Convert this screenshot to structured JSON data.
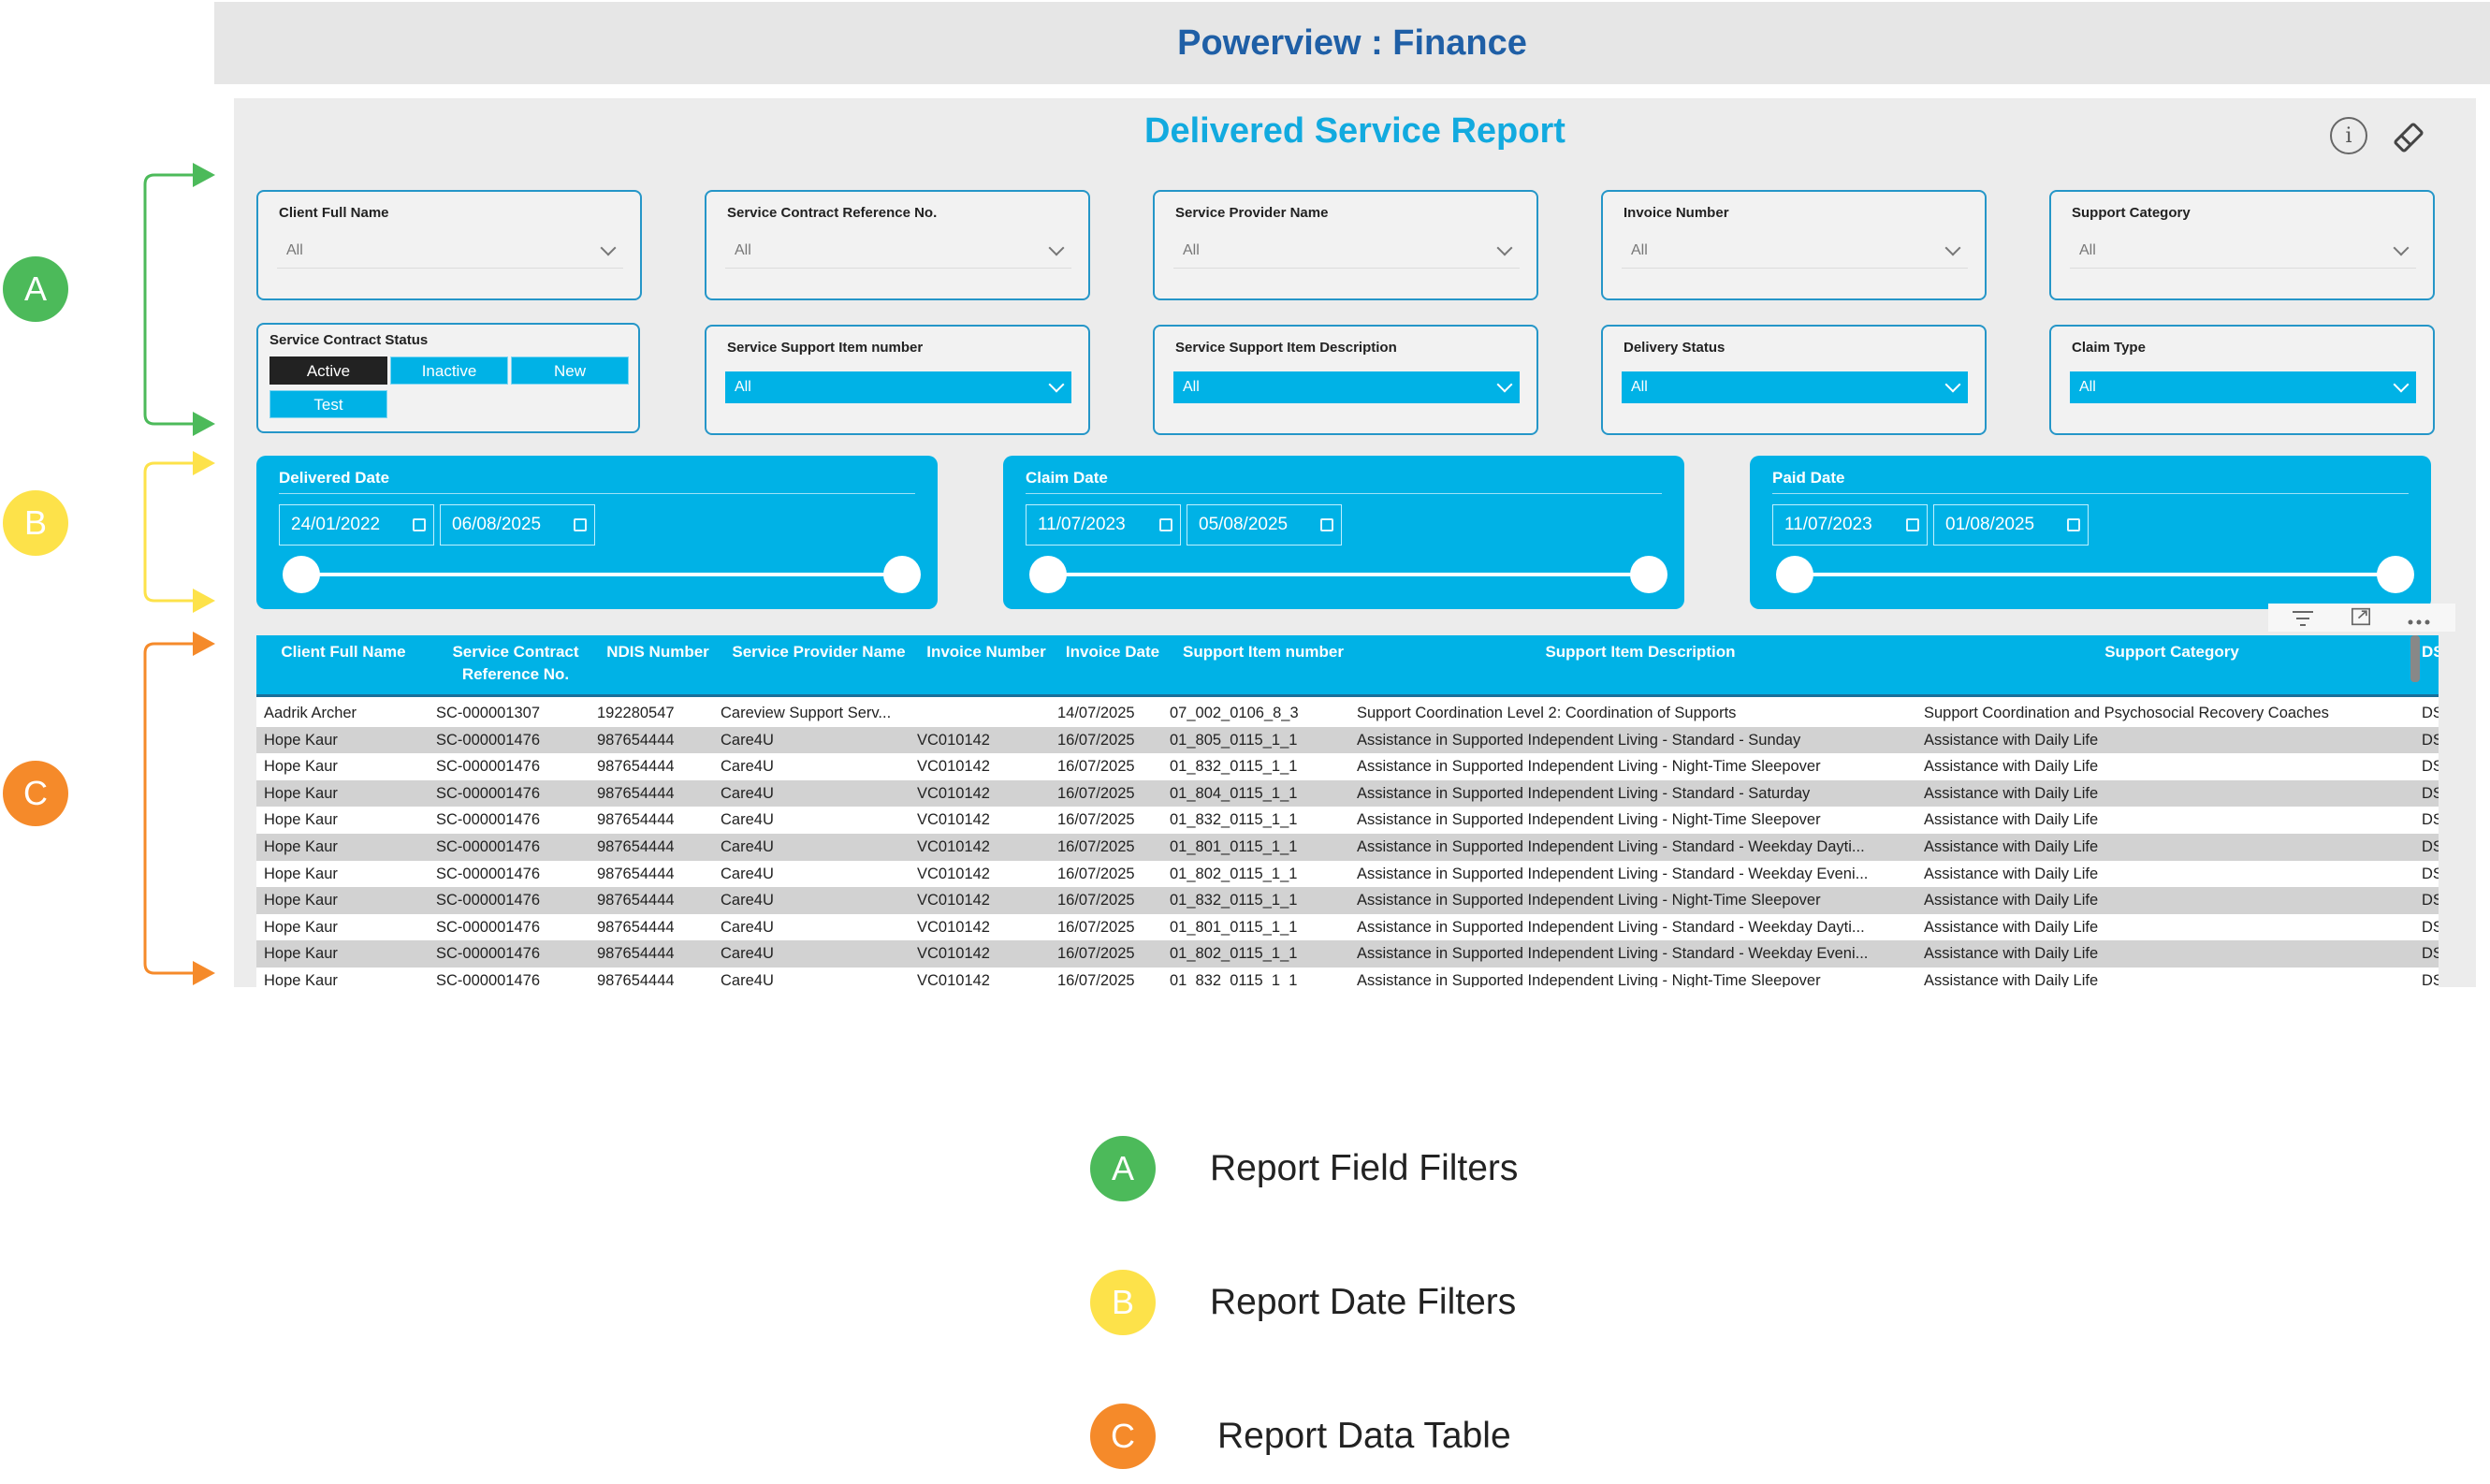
{
  "app": {
    "title": "Powerview : Finance"
  },
  "report": {
    "title": "Delivered Service Report",
    "info_glyph": "i"
  },
  "field_filters": [
    {
      "label": "Client Full Name",
      "value": "All"
    },
    {
      "label": "Service Contract Reference No.",
      "value": "All"
    },
    {
      "label": "Service Provider Name",
      "value": "All"
    },
    {
      "label": "Invoice Number",
      "value": "All"
    },
    {
      "label": "Support Category",
      "value": "All"
    }
  ],
  "field_filters_row2": [
    {
      "label": "Service Support Item number",
      "value": "All"
    },
    {
      "label": "Service Support Item Description",
      "value": "All"
    },
    {
      "label": "Delivery Status",
      "value": "All"
    },
    {
      "label": "Claim Type",
      "value": "All"
    }
  ],
  "contract_status": {
    "label": "Service Contract Status",
    "options": [
      "Active",
      "Inactive",
      "New",
      "Test"
    ],
    "selected": "Active"
  },
  "date_filters": [
    {
      "label": "Delivered Date",
      "from": "24/01/2022",
      "to": "06/08/2025"
    },
    {
      "label": "Claim Date",
      "from": "11/07/2023",
      "to": "05/08/2025"
    },
    {
      "label": "Paid Date",
      "from": "11/07/2023",
      "to": "01/08/2025"
    }
  ],
  "table": {
    "headers": [
      "Client Full Name",
      "Service Contract\nReference No.",
      "NDIS Number",
      "Service Provider Name",
      "Invoice Number",
      "Invoice Date",
      "Support Item number",
      "Support Item Description",
      "Support Category",
      "DS"
    ],
    "rows": [
      [
        "Aadrik Archer",
        "SC-000001307",
        "192280547",
        "Careview Support Serv...",
        "",
        "14/07/2025",
        "07_002_0106_8_3",
        "Support Coordination Level 2: Coordination of Supports",
        "Support Coordination and Psychosocial Recovery Coaches",
        "DS-("
      ],
      [
        "Hope Kaur",
        "SC-000001476",
        "987654444",
        "Care4U",
        "VC010142",
        "16/07/2025",
        "01_805_0115_1_1",
        "Assistance in Supported Independent Living - Standard - Sunday",
        "Assistance with Daily Life",
        "DS-("
      ],
      [
        "Hope Kaur",
        "SC-000001476",
        "987654444",
        "Care4U",
        "VC010142",
        "16/07/2025",
        "01_832_0115_1_1",
        "Assistance in Supported Independent Living - Night-Time Sleepover",
        "Assistance with Daily Life",
        "DS-("
      ],
      [
        "Hope Kaur",
        "SC-000001476",
        "987654444",
        "Care4U",
        "VC010142",
        "16/07/2025",
        "01_804_0115_1_1",
        "Assistance in Supported Independent Living - Standard - Saturday",
        "Assistance with Daily Life",
        "DS-("
      ],
      [
        "Hope Kaur",
        "SC-000001476",
        "987654444",
        "Care4U",
        "VC010142",
        "16/07/2025",
        "01_832_0115_1_1",
        "Assistance in Supported Independent Living - Night-Time Sleepover",
        "Assistance with Daily Life",
        "DS-("
      ],
      [
        "Hope Kaur",
        "SC-000001476",
        "987654444",
        "Care4U",
        "VC010142",
        "16/07/2025",
        "01_801_0115_1_1",
        "Assistance in Supported Independent Living - Standard - Weekday Dayti...",
        "Assistance with Daily Life",
        "DS-("
      ],
      [
        "Hope Kaur",
        "SC-000001476",
        "987654444",
        "Care4U",
        "VC010142",
        "16/07/2025",
        "01_802_0115_1_1",
        "Assistance in Supported Independent Living - Standard - Weekday Eveni...",
        "Assistance with Daily Life",
        "DS-("
      ],
      [
        "Hope Kaur",
        "SC-000001476",
        "987654444",
        "Care4U",
        "VC010142",
        "16/07/2025",
        "01_832_0115_1_1",
        "Assistance in Supported Independent Living - Night-Time Sleepover",
        "Assistance with Daily Life",
        "DS-("
      ],
      [
        "Hope Kaur",
        "SC-000001476",
        "987654444",
        "Care4U",
        "VC010142",
        "16/07/2025",
        "01_801_0115_1_1",
        "Assistance in Supported Independent Living - Standard - Weekday Dayti...",
        "Assistance with Daily Life",
        "DS-("
      ],
      [
        "Hope Kaur",
        "SC-000001476",
        "987654444",
        "Care4U",
        "VC010142",
        "16/07/2025",
        "01_802_0115_1_1",
        "Assistance in Supported Independent Living - Standard - Weekday Eveni...",
        "Assistance with Daily Life",
        "DS-("
      ],
      [
        "Hope Kaur",
        "SC-000001476",
        "987654444",
        "Care4U",
        "VC010142",
        "16/07/2025",
        "01_832_0115_1_1",
        "Assistance in Supported Independent Living - Night-Time Sleepover",
        "Assistance with Daily Life",
        "DS-("
      ]
    ]
  },
  "annotations": [
    {
      "letter": "A",
      "label": "Report Field Filters",
      "color": "#4cba5a"
    },
    {
      "letter": "B",
      "label": "Report Date Filters",
      "color": "#fde24a"
    },
    {
      "letter": "C",
      "label": "Report Data Table",
      "color": "#f58a2a"
    }
  ],
  "colors": {
    "accent": "#00b2e6",
    "title_blue": "#1f5fa6",
    "active_chip": "#222222"
  }
}
